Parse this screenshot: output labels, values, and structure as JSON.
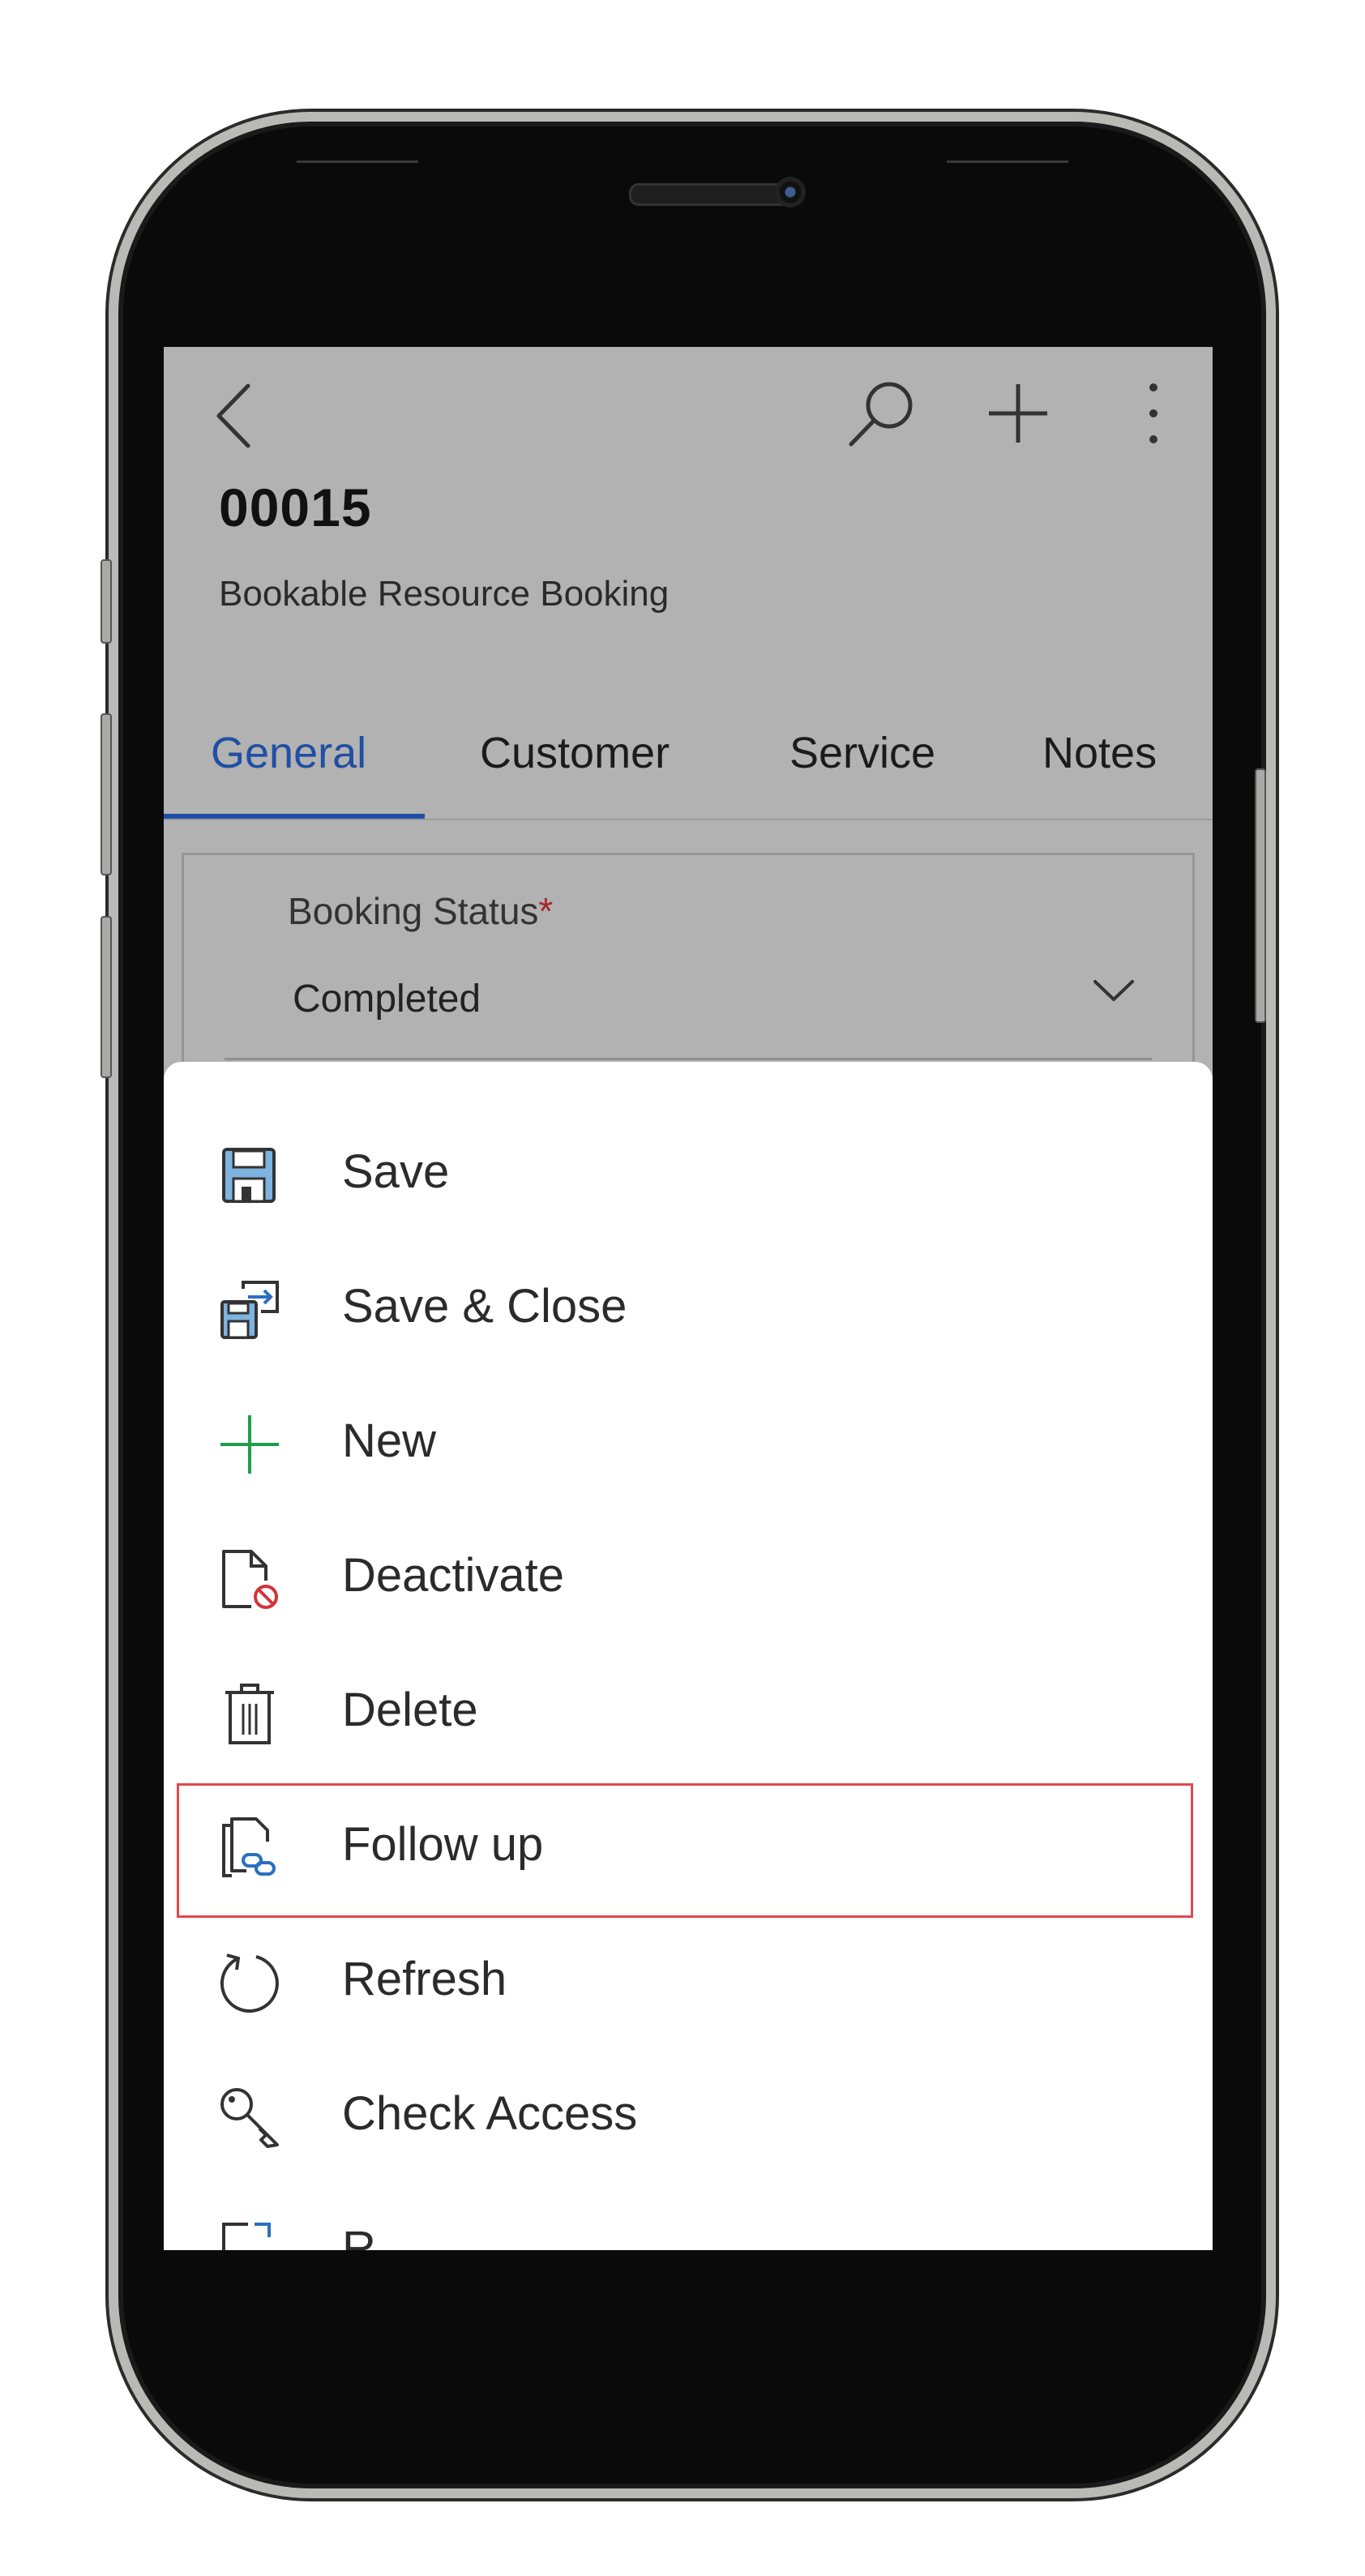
{
  "header": {
    "record_title": "00015",
    "entity_name": "Bookable Resource Booking"
  },
  "tabs": [
    {
      "label": "General",
      "active": true
    },
    {
      "label": "Customer",
      "active": false
    },
    {
      "label": "Service",
      "active": false
    },
    {
      "label": "Notes",
      "active": false
    }
  ],
  "booking_status": {
    "label": "Booking Status",
    "required_marker": "*",
    "value": "Completed"
  },
  "menu": {
    "items": [
      {
        "label": "Save",
        "icon": "save-icon"
      },
      {
        "label": "Save & Close",
        "icon": "save-close-icon"
      },
      {
        "label": "New",
        "icon": "plus-icon"
      },
      {
        "label": "Deactivate",
        "icon": "deactivate-icon"
      },
      {
        "label": "Delete",
        "icon": "trash-icon"
      },
      {
        "label": "Follow up",
        "icon": "follow-up-icon",
        "highlighted": true
      },
      {
        "label": "Refresh",
        "icon": "refresh-icon"
      },
      {
        "label": "Check Access",
        "icon": "key-icon"
      }
    ],
    "cut_off_item_label": "R"
  },
  "colors": {
    "accent": "#1f4fa5",
    "overlay_grey": "#b2b2b2",
    "highlight_border": "#e0484f",
    "new_icon_green": "#1e9e4a"
  }
}
